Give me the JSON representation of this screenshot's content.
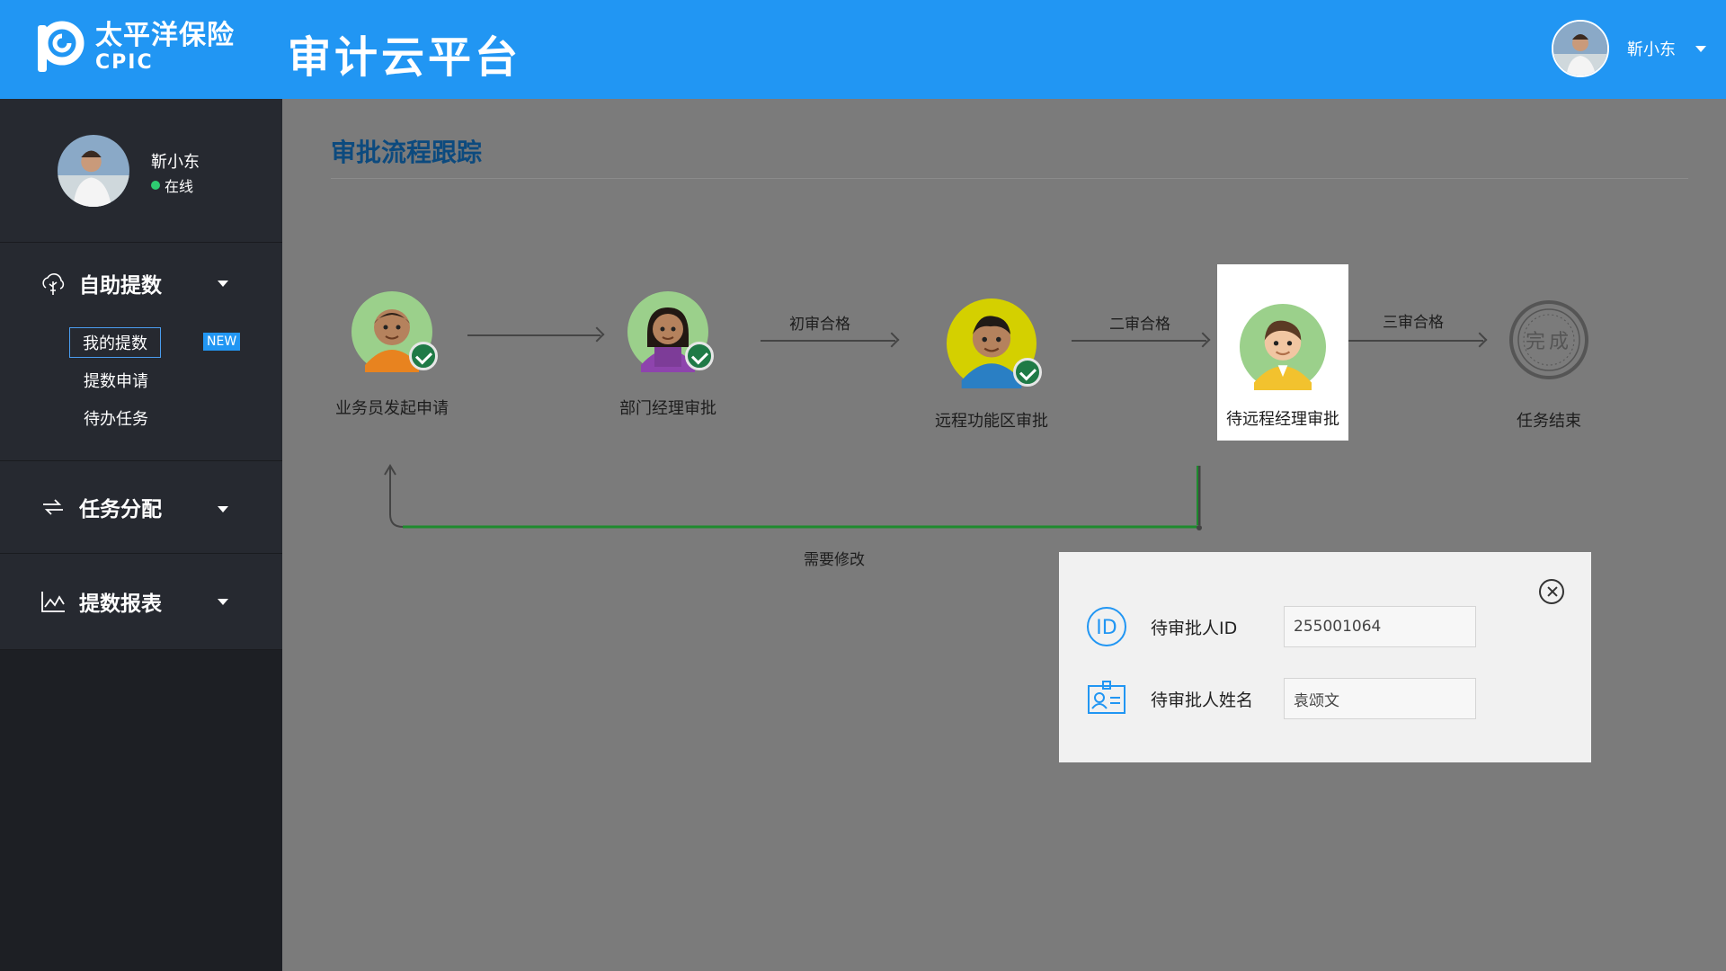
{
  "header": {
    "logo_cn": "太平洋保险",
    "logo_en": "CPIC",
    "app_title": "审计云平台",
    "user_name": "靳小东"
  },
  "sidebar": {
    "profile": {
      "name": "靳小东",
      "status": "在线"
    },
    "groups": [
      {
        "label": "自助提数",
        "icon": "cloud-tree-icon",
        "items": [
          {
            "label": "我的提数",
            "badge": "NEW",
            "active": true
          },
          {
            "label": "提数申请"
          },
          {
            "label": "待办任务"
          }
        ]
      },
      {
        "label": "任务分配",
        "icon": "swap-arrows-icon"
      },
      {
        "label": "提数报表",
        "icon": "line-chart-icon"
      }
    ]
  },
  "main": {
    "title": "审批流程跟踪",
    "steps": [
      {
        "label": "业务员发起申请",
        "done": true
      },
      {
        "label": "部门经理审批",
        "done": true
      },
      {
        "label": "远程功能区审批",
        "done": true
      },
      {
        "label": "待远程经理审批",
        "current": true
      },
      {
        "label": "任务结束",
        "stamp": "完成"
      }
    ],
    "transitions": [
      "",
      "初审合格",
      "二审合格",
      "三审合格"
    ],
    "feedback_label": "需要修改"
  },
  "popup": {
    "id_label": "待审批人ID",
    "id_value": "255001064",
    "name_label": "待审批人姓名",
    "name_value": "袁颂文"
  },
  "colors": {
    "header": "#2196f3",
    "sidebar": "#1d1f24",
    "accent_green": "#1f7a46",
    "title": "#0c4a7e"
  }
}
